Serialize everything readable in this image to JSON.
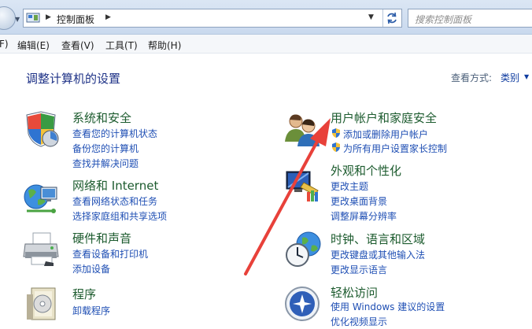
{
  "window": {
    "address": {
      "path": "控制面板",
      "icon": "control-panel-icon"
    },
    "search": {
      "placeholder": "搜索控制面板"
    },
    "menu": [
      {
        "label": "F)"
      },
      {
        "label": "编辑(E)"
      },
      {
        "label": "查看(V)"
      },
      {
        "label": "工具(T)"
      },
      {
        "label": "帮助(H)"
      }
    ]
  },
  "main": {
    "title": "调整计算机的设置",
    "view_by": {
      "label": "查看方式:",
      "value": "类别"
    },
    "categories": [
      {
        "title": "系统和安全",
        "icon": "shield-security-icon",
        "links": [
          "查看您的计算机状态",
          "备份您的计算机",
          "查找并解决问题"
        ]
      },
      {
        "title": "网络和 Internet",
        "icon": "network-globe-icon",
        "links": [
          "查看网络状态和任务",
          "选择家庭组和共享选项"
        ]
      },
      {
        "title": "硬件和声音",
        "icon": "printer-icon",
        "links": [
          "查看设备和打印机",
          "添加设备"
        ]
      },
      {
        "title": "程序",
        "icon": "programs-icon",
        "links": [
          "卸载程序"
        ]
      },
      {
        "title": "用户帐户和家庭安全",
        "icon": "users-icon",
        "links": [
          "添加或删除用户帐户",
          "为所有用户设置家长控制"
        ]
      },
      {
        "title": "外观和个性化",
        "icon": "appearance-icon",
        "links": [
          "更改主题",
          "更改桌面背景",
          "调整屏幕分辨率"
        ]
      },
      {
        "title": "时钟、语言和区域",
        "icon": "clock-globe-icon",
        "links": [
          "更改键盘或其他输入法",
          "更改显示语言"
        ]
      },
      {
        "title": "轻松访问",
        "icon": "ease-of-access-icon",
        "links": [
          "使用 Windows 建议的设置",
          "优化视频显示"
        ]
      }
    ]
  },
  "colors": {
    "annotation_arrow": "#e8413a",
    "title_green": "#1c5b2e",
    "link_blue": "#1f4fb4"
  }
}
